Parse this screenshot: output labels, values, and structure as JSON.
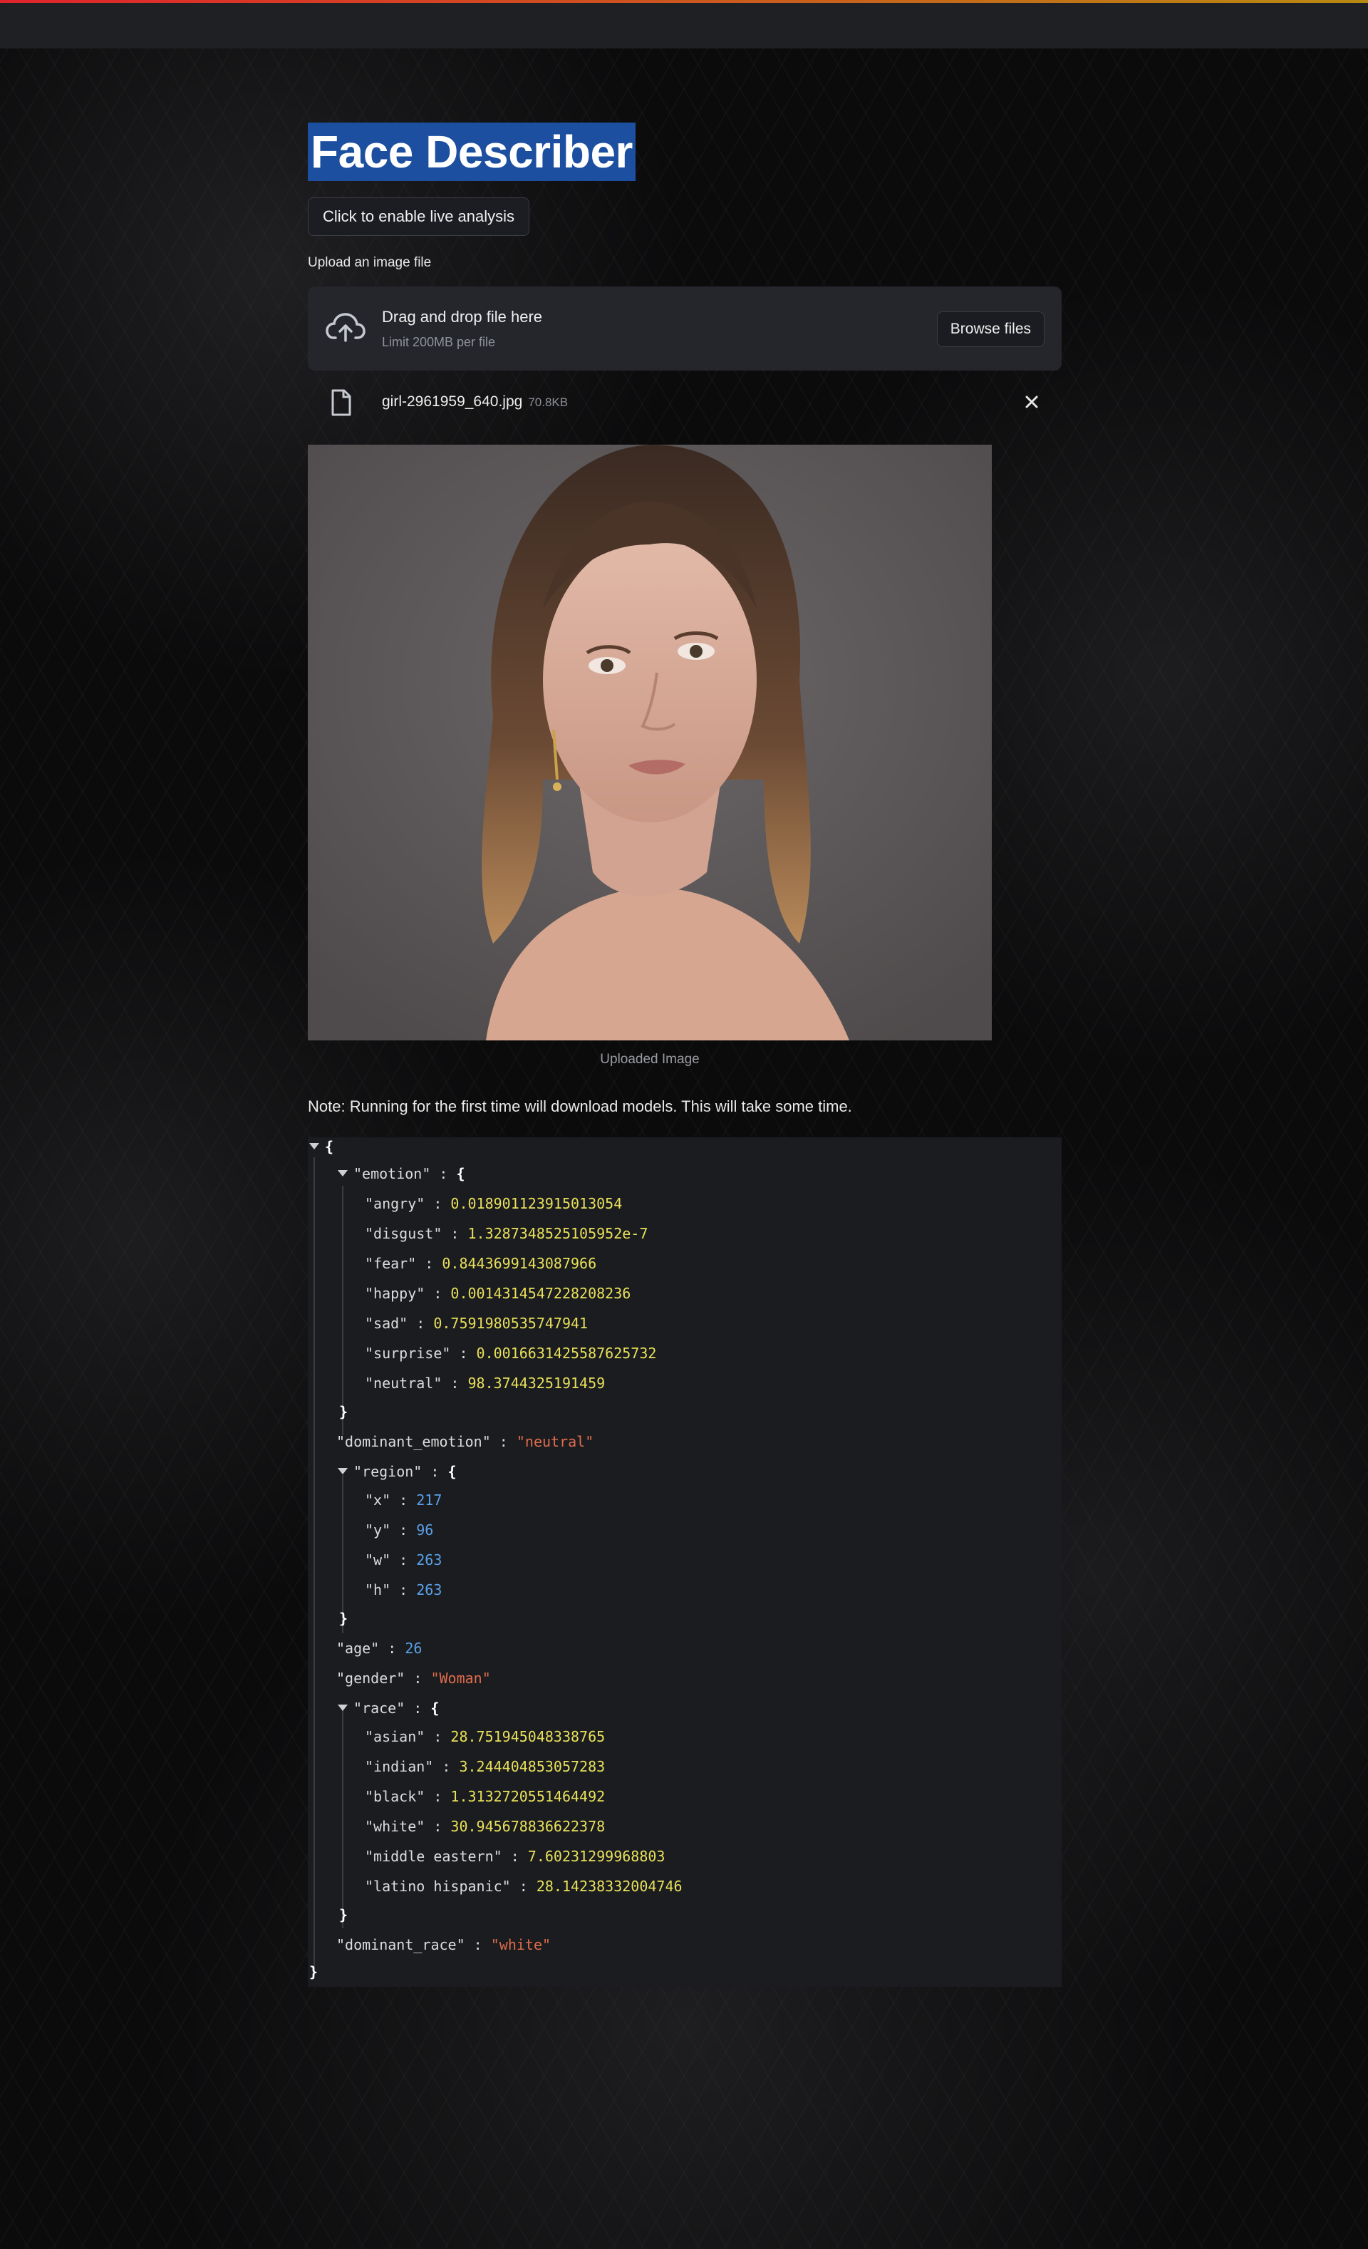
{
  "title": "Face Describer",
  "live_button": "Click to enable live analysis",
  "upload": {
    "label": "Upload an image file",
    "drop_title": "Drag and drop file here",
    "drop_limit": "Limit 200MB per file",
    "browse": "Browse files",
    "file_name": "girl-2961959_640.jpg",
    "file_size": "70.8KB"
  },
  "caption": "Uploaded Image",
  "note": "Note: Running for the first time will download models. This will take some time.",
  "icons": {
    "upload": "cloud-upload-icon",
    "file": "file-icon",
    "close": "close-icon",
    "collapse": "collapse-triangle-icon"
  },
  "colors": {
    "title_highlight": "#1d4fa0",
    "json_key": "#dcdcdc",
    "json_int": "#5aa0e6",
    "json_float": "#e8e05a",
    "json_string": "#e06c4b"
  },
  "result": {
    "emotion": {
      "angry": "0.018901123915013054",
      "disgust": "1.3287348525105952e-7",
      "fear": "0.8443699143087966",
      "happy": "0.0014314547228208236",
      "sad": "0.7591980535747941",
      "surprise": "0.0016631425587625732",
      "neutral": "98.3744325191459"
    },
    "dominant_emotion": "\"neutral\"",
    "region": {
      "x": "217",
      "y": "96",
      "w": "263",
      "h": "263"
    },
    "age": "26",
    "gender": "\"Woman\"",
    "race": {
      "asian": "28.751945048338765",
      "indian": "3.244404853057283",
      "black": "1.3132720551464492",
      "white": "30.945678836622378",
      "middle_eastern": "7.60231299968803",
      "latino_hispanic": "28.14238332004746"
    },
    "dominant_race": "\"white\""
  },
  "keys": {
    "emotion": "\"emotion\"",
    "angry": "\"angry\"",
    "disgust": "\"disgust\"",
    "fear": "\"fear\"",
    "happy": "\"happy\"",
    "sad": "\"sad\"",
    "surprise": "\"surprise\"",
    "neutral": "\"neutral\"",
    "dominant_emotion": "\"dominant_emotion\"",
    "region": "\"region\"",
    "x": "\"x\"",
    "y": "\"y\"",
    "w": "\"w\"",
    "h": "\"h\"",
    "age": "\"age\"",
    "gender": "\"gender\"",
    "race": "\"race\"",
    "asian": "\"asian\"",
    "indian": "\"indian\"",
    "black": "\"black\"",
    "white": "\"white\"",
    "middle_eastern": "\"middle eastern\"",
    "latino_hispanic": "\"latino hispanic\"",
    "dominant_race": "\"dominant_race\""
  }
}
